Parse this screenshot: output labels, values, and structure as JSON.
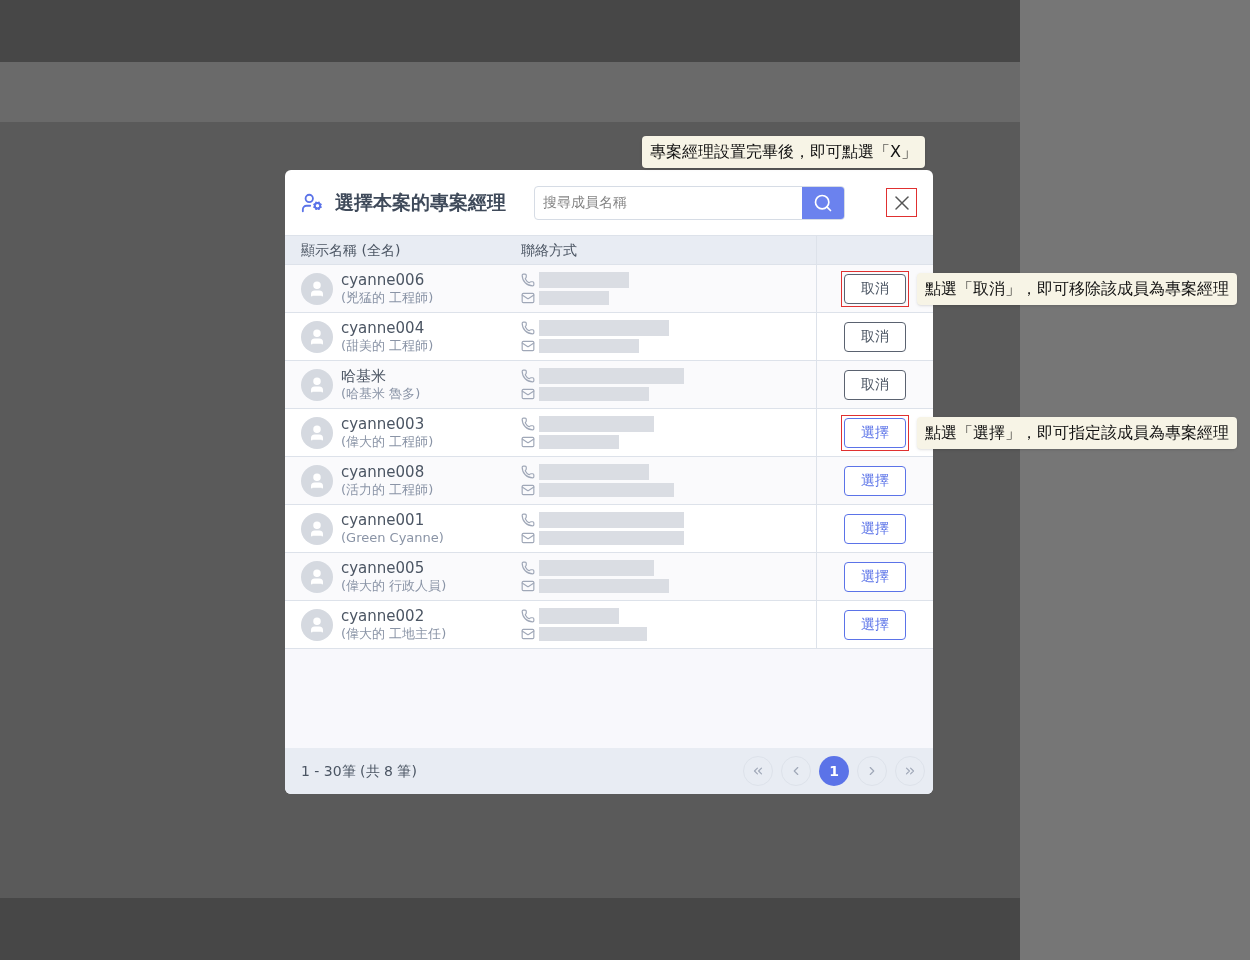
{
  "dialog": {
    "title": "選擇本案的專案經理",
    "search": {
      "placeholder": "搜尋成員名稱"
    },
    "close": {
      "highlighted": true,
      "callout": "專案經理設置完畢後，即可點選「X」"
    },
    "columns": [
      "顯示名稱 (全名)",
      "聯絡方式"
    ],
    "rows": [
      {
        "name": "cyanne006",
        "full_name": "(兇猛的 工程師)",
        "assigned": true,
        "action": "取消",
        "highlighted": true,
        "callout": "點選「取消」，即可移除該成員為專案經理"
      },
      {
        "name": "cyanne004",
        "full_name": "(甜美的 工程師)",
        "assigned": true,
        "action": "取消",
        "highlighted": false
      },
      {
        "name": "哈基米",
        "full_name": "(哈基米 魯多)",
        "assigned": true,
        "action": "取消",
        "highlighted": false
      },
      {
        "name": "cyanne003",
        "full_name": "(偉大的 工程師)",
        "assigned": false,
        "action": "選擇",
        "highlighted": true,
        "callout": "點選「選擇」，即可指定該成員為專案經理"
      },
      {
        "name": "cyanne008",
        "full_name": "(活力的 工程師)",
        "assigned": false,
        "action": "選擇",
        "highlighted": false
      },
      {
        "name": "cyanne001",
        "full_name": "(Green Cyanne)",
        "assigned": false,
        "action": "選擇",
        "highlighted": false
      },
      {
        "name": "cyanne005",
        "full_name": "(偉大的 行政人員)",
        "assigned": false,
        "action": "選擇",
        "highlighted": false
      },
      {
        "name": "cyanne002",
        "full_name": "(偉大的 工地主任)",
        "assigned": false,
        "action": "選擇",
        "highlighted": false
      }
    ],
    "footer": {
      "summary": "1 - 30筆 (共 8 筆)",
      "pages": [
        {
          "kind": "first"
        },
        {
          "kind": "prev"
        },
        {
          "kind": "page",
          "label": "1",
          "selected": true
        },
        {
          "kind": "next"
        },
        {
          "kind": "last"
        }
      ]
    }
  }
}
